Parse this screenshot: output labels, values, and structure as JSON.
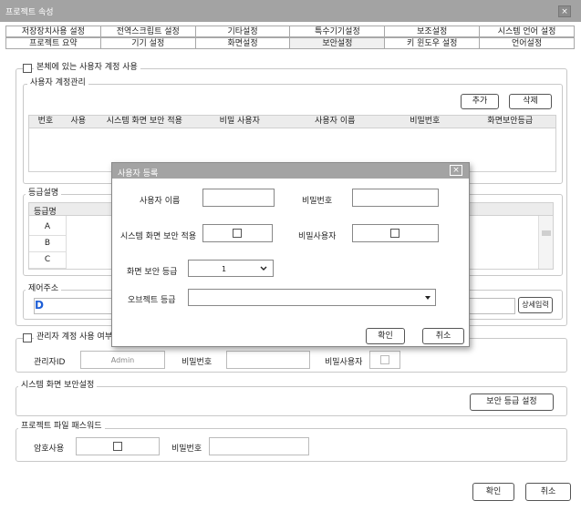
{
  "window": {
    "title": "프로젝트 속성",
    "close_glyph": "×"
  },
  "tabs_row1": [
    "저장장치사용 설정",
    "전역스크립트 설정",
    "기타설정",
    "특수기기설정",
    "보조설정",
    "시스템 언어 설정"
  ],
  "tabs_row2": [
    "프로젝트 요약",
    "기기 설정",
    "화면설정",
    "보안설정",
    "키 윈도우 설정",
    "언어설정"
  ],
  "active_tab": "보안설정",
  "use_account": {
    "label": "본체에 있는 사용자 계정 사용"
  },
  "user_mgmt": {
    "title": "사용자 계정관리",
    "add_label": "추가",
    "delete_label": "삭제",
    "columns": [
      "번호",
      "사용",
      "시스템 화면 보안 적용",
      "비밀 사용자",
      "사용자 이름",
      "비밀번호",
      "화면보안등급"
    ]
  },
  "grade_desc": {
    "title": "등급설명",
    "header": "등급명",
    "rows": [
      "A",
      "B",
      "C"
    ]
  },
  "control_addr": {
    "title": "제어주소",
    "value": "D",
    "detail_button": "상세입력"
  },
  "admin": {
    "title": "관리자 계정 사용 여부",
    "id_label": "관리자ID",
    "id_value": "Admin",
    "pw_label": "비밀번호",
    "secret_label": "비밀사용자"
  },
  "screen_security": {
    "title": "시스템 화면 보안설정",
    "button": "보안 등급 설정"
  },
  "project_pw": {
    "title": "프로젝트 파일 패스워드",
    "use_label": "암호사용",
    "pw_label": "비밀번호"
  },
  "footer": {
    "ok": "확인",
    "cancel": "취소"
  },
  "dialog": {
    "title": "사용자 등록",
    "close_glyph": "×",
    "user_name_label": "사용자 이름",
    "password_label": "비밀번호",
    "sys_security_label": "시스템 화면 보안 적용",
    "secret_user_label": "비밀사용자",
    "grade_label": "화면 보안 등급",
    "grade_value": "1",
    "object_grade_label": "오브젝트 등급",
    "ok": "확인",
    "cancel": "취소"
  }
}
